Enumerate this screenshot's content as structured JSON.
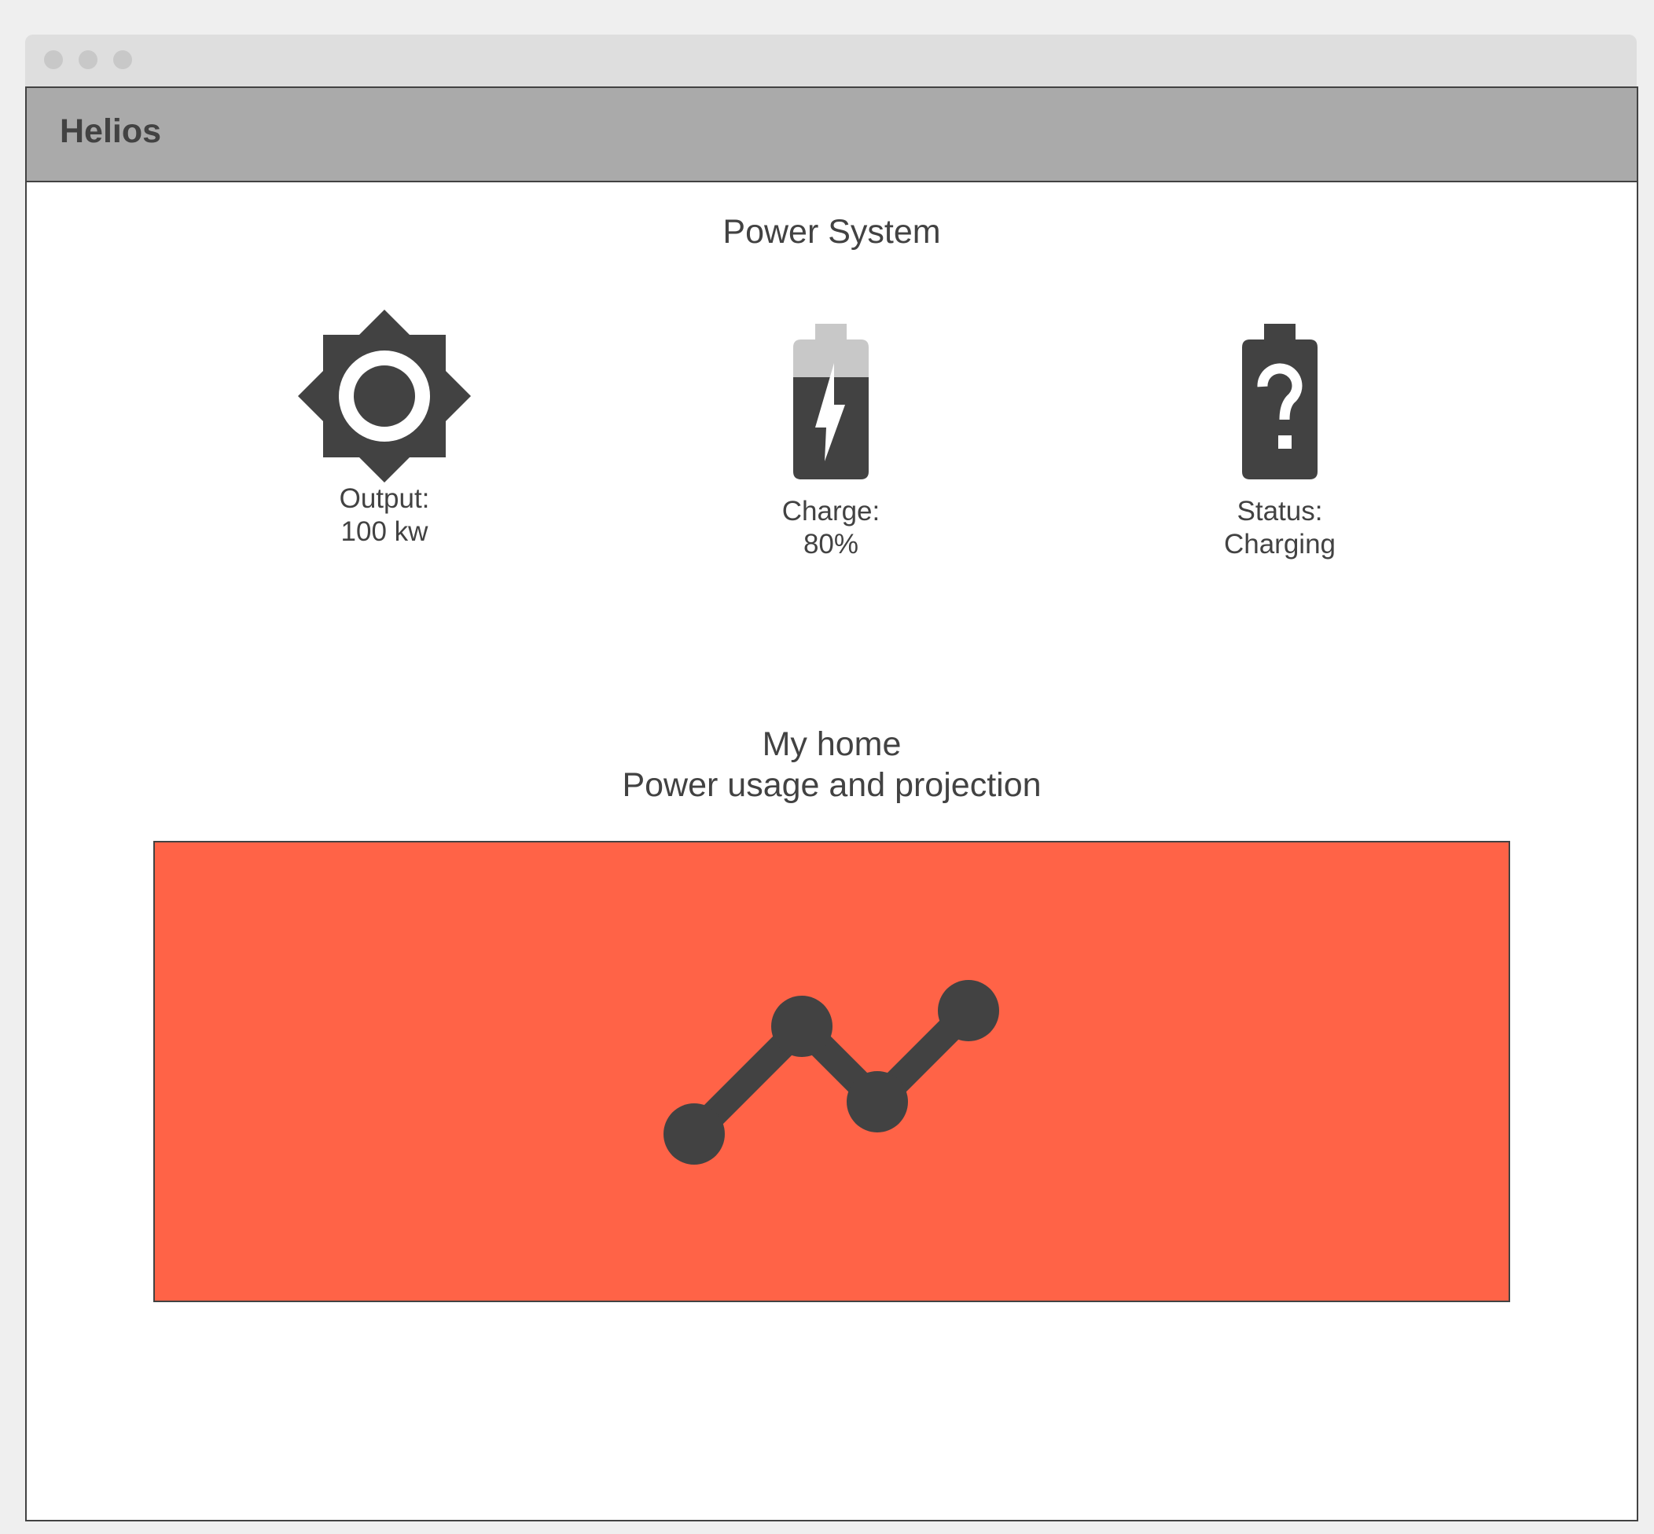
{
  "app": {
    "title": "Helios"
  },
  "power_system": {
    "title": "Power System",
    "output": {
      "label": "Output:",
      "value": "100 kw",
      "icon": "brightness-icon"
    },
    "charge": {
      "label": "Charge:",
      "value": "80%",
      "icon": "battery-charging-icon"
    },
    "status": {
      "label": "Status:",
      "value": "Charging",
      "icon": "battery-unknown-icon"
    }
  },
  "home": {
    "title_line1": "My home",
    "title_line2": "Power usage and projection",
    "chart_icon": "line-chart-icon"
  },
  "colors": {
    "chart_bg": "#ff6347",
    "icon": "#424242",
    "header_bg": "#aaaaaa",
    "battery_empty": "#c8c8c8"
  }
}
